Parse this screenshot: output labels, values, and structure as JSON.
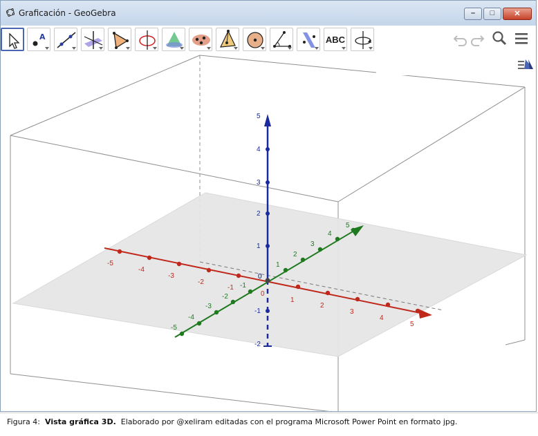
{
  "window": {
    "title": "Graficación - GeoGebra",
    "minimize_glyph": "–",
    "maximize_glyph": "□",
    "close_glyph": "✕"
  },
  "toolbar": {
    "tools": [
      {
        "icon": "move-arrow-icon",
        "selected": true
      },
      {
        "icon": "point-icon"
      },
      {
        "icon": "line-icon"
      },
      {
        "icon": "perpendicular-line-icon"
      },
      {
        "icon": "polygon-icon"
      },
      {
        "icon": "circle-around-axis-icon"
      },
      {
        "icon": "intersect-surfaces-icon"
      },
      {
        "icon": "plane-through-points-icon"
      },
      {
        "icon": "pyramid-icon"
      },
      {
        "icon": "sphere-icon"
      },
      {
        "icon": "angle-icon"
      },
      {
        "icon": "reflect-about-plane-icon"
      },
      {
        "icon": "text-tool-icon",
        "label": "ABC"
      },
      {
        "icon": "rotate-3d-view-icon"
      }
    ],
    "undo_icon": "undo-icon",
    "redo_icon": "redo-icon",
    "search_icon": "search-icon",
    "menu_icon": "menu-icon",
    "style_bar_icon": "style-bar-toggle-icon"
  },
  "graphics3d": {
    "x_axis": {
      "color": "#c0281c",
      "ticks": [
        "-5",
        "-4",
        "-3",
        "-2",
        "-1",
        "0",
        "1",
        "2",
        "3",
        "4",
        "5"
      ]
    },
    "y_axis": {
      "color": "#1f7a1f",
      "ticks": [
        "-5",
        "-4",
        "-3",
        "-2",
        "-1",
        "0",
        "1",
        "2",
        "3",
        "4",
        "5"
      ]
    },
    "z_axis": {
      "color": "#1a2a9c",
      "ticks": [
        "-2",
        "-1",
        "0",
        "1",
        "2",
        "3",
        "4",
        "5"
      ]
    },
    "plane_color": "#e6e6e6"
  },
  "caption": {
    "prefix": "Figura 4:",
    "title": "Vista gráfica 3D.",
    "text": "Elaborado por @xeliram editadas con el programa Microsoft Power Point en formato jpg."
  }
}
